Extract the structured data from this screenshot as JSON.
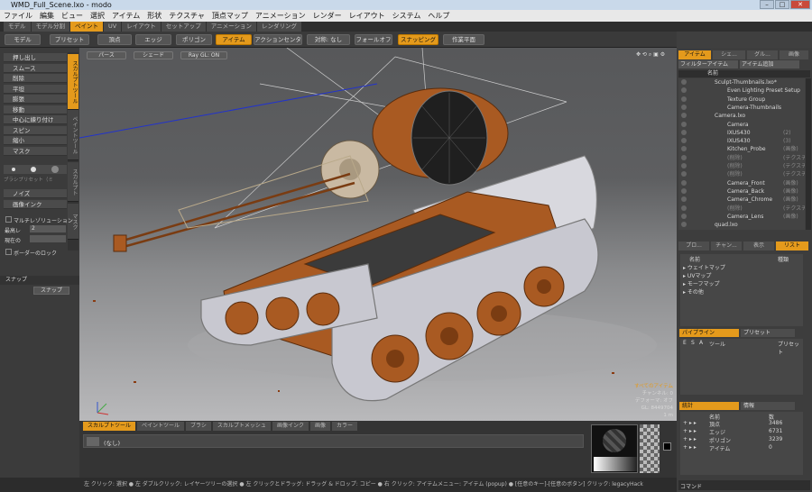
{
  "window": {
    "title": "WMD_Full_Scene.lxo - modo"
  },
  "menu": [
    "ファイル",
    "編集",
    "ビュー",
    "選択",
    "アイテム",
    "形状",
    "テクスチャ",
    "頂点マップ",
    "アニメーション",
    "レンダー",
    "レイアウト",
    "システム",
    "ヘルプ"
  ],
  "layout_tabs": [
    "モデル",
    "モデル分割",
    "ペイント",
    "UV",
    "レイアウト",
    "セットアップ",
    "アニメーション",
    "レンダリング"
  ],
  "toolbar": {
    "model": "モデル",
    "preset": "プリセット",
    "vertex": "頂点",
    "edge": "エッジ",
    "polygon": "ポリゴン",
    "item": "アイテム",
    "action_center": "アクションセンター",
    "symmetry": "対称: なし",
    "falloff": "フォールオフ",
    "snapping": "スナッピング",
    "work_plane": "作業平面"
  },
  "left_tabs": [
    "スカルプトツール",
    "ペイントツール",
    "スカルプト",
    "マスク"
  ],
  "sculpt_tools": [
    "押し出し",
    "スムース",
    "削除",
    "平坦",
    "膨張",
    "移動",
    "中心に練り付け",
    "スピン",
    "縮小",
    "マスク"
  ],
  "brush": {
    "presets_label": "ブラシプリセット（ミ",
    "noise": "ノイズ",
    "image_ink": "画像インク",
    "multires": "マルチレゾリューション",
    "max_level_label": "最高レ",
    "max_level_value": "2",
    "current_label": "現在の",
    "border_lock": "ボーダーのロック",
    "snap_header": "スナップ",
    "snap_button": "スナップ"
  },
  "viewport": {
    "perspective": "パース",
    "shade": "シェード",
    "raygl": "Ray GL: ON",
    "info_all": "すべてのアイテム",
    "info_channels": "チャンネル: 0",
    "info_deform": "デフォーマ: オフ",
    "info_gl": "GL: 8449704",
    "info_scale": "1 m"
  },
  "items_panel": {
    "tabs": [
      "アイテム",
      "シェ...",
      "グル...",
      "画像"
    ],
    "filter": "フィルターアイテム",
    "add": "アイテム追加",
    "col_name": "名前",
    "rows": [
      {
        "text": "Sculpt-Thumbnails.lxo*",
        "indent": 0
      },
      {
        "text": "Even Lighting Preset Setup",
        "indent": 2
      },
      {
        "text": "Texture Group",
        "indent": 2
      },
      {
        "text": "Camera-Thumbnails",
        "indent": 2
      },
      {
        "text": "Camera.lxo",
        "indent": 0
      },
      {
        "text": "Camera",
        "indent": 2
      },
      {
        "text": "IXUS430",
        "suffix": "(2)",
        "indent": 2
      },
      {
        "text": "IXUS430",
        "suffix": "(3)",
        "indent": 2
      },
      {
        "text": "Kitchen_Probe",
        "suffix": "(画像)",
        "indent": 2
      },
      {
        "text": "(削除)",
        "suffix": "(テクスチャ)",
        "indent": 2,
        "dim": true
      },
      {
        "text": "(削除)",
        "suffix": "(テクスチャ)",
        "indent": 2,
        "dim": true
      },
      {
        "text": "(削除)",
        "suffix": "(テクスチャ)",
        "indent": 2,
        "dim": true
      },
      {
        "text": "Camera_Front",
        "suffix": "(画像)",
        "indent": 2
      },
      {
        "text": "Camera_Back",
        "suffix": "(画像)",
        "indent": 2
      },
      {
        "text": "Camera_Chrome",
        "suffix": "(画像)",
        "indent": 2
      },
      {
        "text": "(削除)",
        "suffix": "(テクスチャ)",
        "indent": 2,
        "dim": true
      },
      {
        "text": "Camera_Lens",
        "suffix": "(画像)",
        "indent": 2
      },
      {
        "text": "quad.lxo",
        "indent": 0
      }
    ]
  },
  "list_panel": {
    "tabs": [
      "プロ...",
      "チャン...",
      "表示",
      "リスト"
    ],
    "col_name": "名前",
    "col_type": "種類",
    "rows": [
      "ウェイトマップ",
      "UVマップ",
      "モーフマップ",
      "その他"
    ]
  },
  "pipeline": {
    "tab1": "パイプライン",
    "tab2": "プリセット",
    "col_e": "E",
    "col_s": "S",
    "col_a": "A",
    "col_tool": "ツール",
    "col_preset": "プリセット"
  },
  "stats": {
    "tab1": "統計",
    "tab2": "情報",
    "col_name": "名前",
    "col_count": "数",
    "rows": [
      {
        "name": "頂点",
        "count": "3486"
      },
      {
        "name": "エッジ",
        "count": "6731"
      },
      {
        "name": "ポリゴン",
        "count": "3239"
      },
      {
        "name": "アイテム",
        "count": "0"
      }
    ]
  },
  "command": {
    "label": "コマンド"
  },
  "bottom_tabs": [
    "スカルプトツール",
    "ペイントツール",
    "ブラシ",
    "スカルプトメッシュ",
    "画像インク",
    "画像",
    "カラー"
  ],
  "bottom_field": "(なし)",
  "status_text": "左 クリック: 選択 ● 左 ダブルクリック: レイヤーツリーの選択 ● 左 クリックとドラッグ: ドラッグ & ドロップ: コピー ● 右 クリック: アイテムメニュー: アイテム (popup) ● [任意のキー]-[任意のボタン] クリック: legacyHack",
  "colors": {
    "accent": "#e49a1c",
    "tank_body": "#a95a22",
    "track": "#c8c8d0"
  }
}
